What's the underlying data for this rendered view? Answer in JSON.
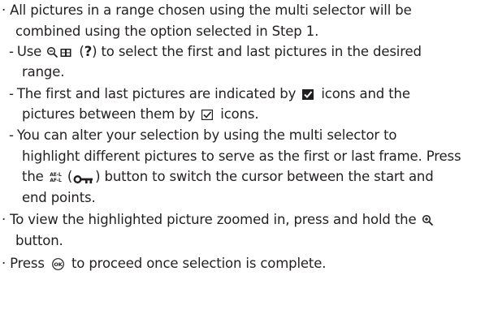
{
  "lines": {
    "l1": {
      "text": "All pictures in a range chosen using the multi selector will be"
    },
    "l2": {
      "text": "combined using the option selected in Step 1."
    },
    "l3": {
      "a": "Use ",
      "paren_open": " (",
      "bold_q": "?",
      "b": ") to select the first and last pictures in the desired"
    },
    "l4": {
      "text": "range."
    },
    "l5": {
      "a": "The first and last pictures are indicated by ",
      "b": " icons and the"
    },
    "l6": {
      "a": "pictures between them by ",
      "b": " icons."
    },
    "l7": {
      "text": "You can alter your selection by using the multi selector to"
    },
    "l8": {
      "text": "highlight different pictures to serve as the first or last frame. Press"
    },
    "l9": {
      "a": "the ",
      "paren_open": " (",
      "b": ") button to switch the cursor between the start and"
    },
    "l10": {
      "text": "end points."
    },
    "l11": {
      "a": "To view the highlighted picture zoomed in, press and hold the "
    },
    "l12": {
      "text": "button."
    },
    "l13": {
      "a": "Press ",
      "b": " to proceed once selection is complete."
    }
  },
  "bullet": "·",
  "dash": "-",
  "icons": [
    "zoom-out-icon",
    "thumbnail-icon",
    "check-filled-icon",
    "check-outline-icon",
    "ae-af-lock-icon",
    "protect-key-icon",
    "zoom-in-icon",
    "ok-button-icon"
  ],
  "colors": {
    "text": "#231f20"
  }
}
